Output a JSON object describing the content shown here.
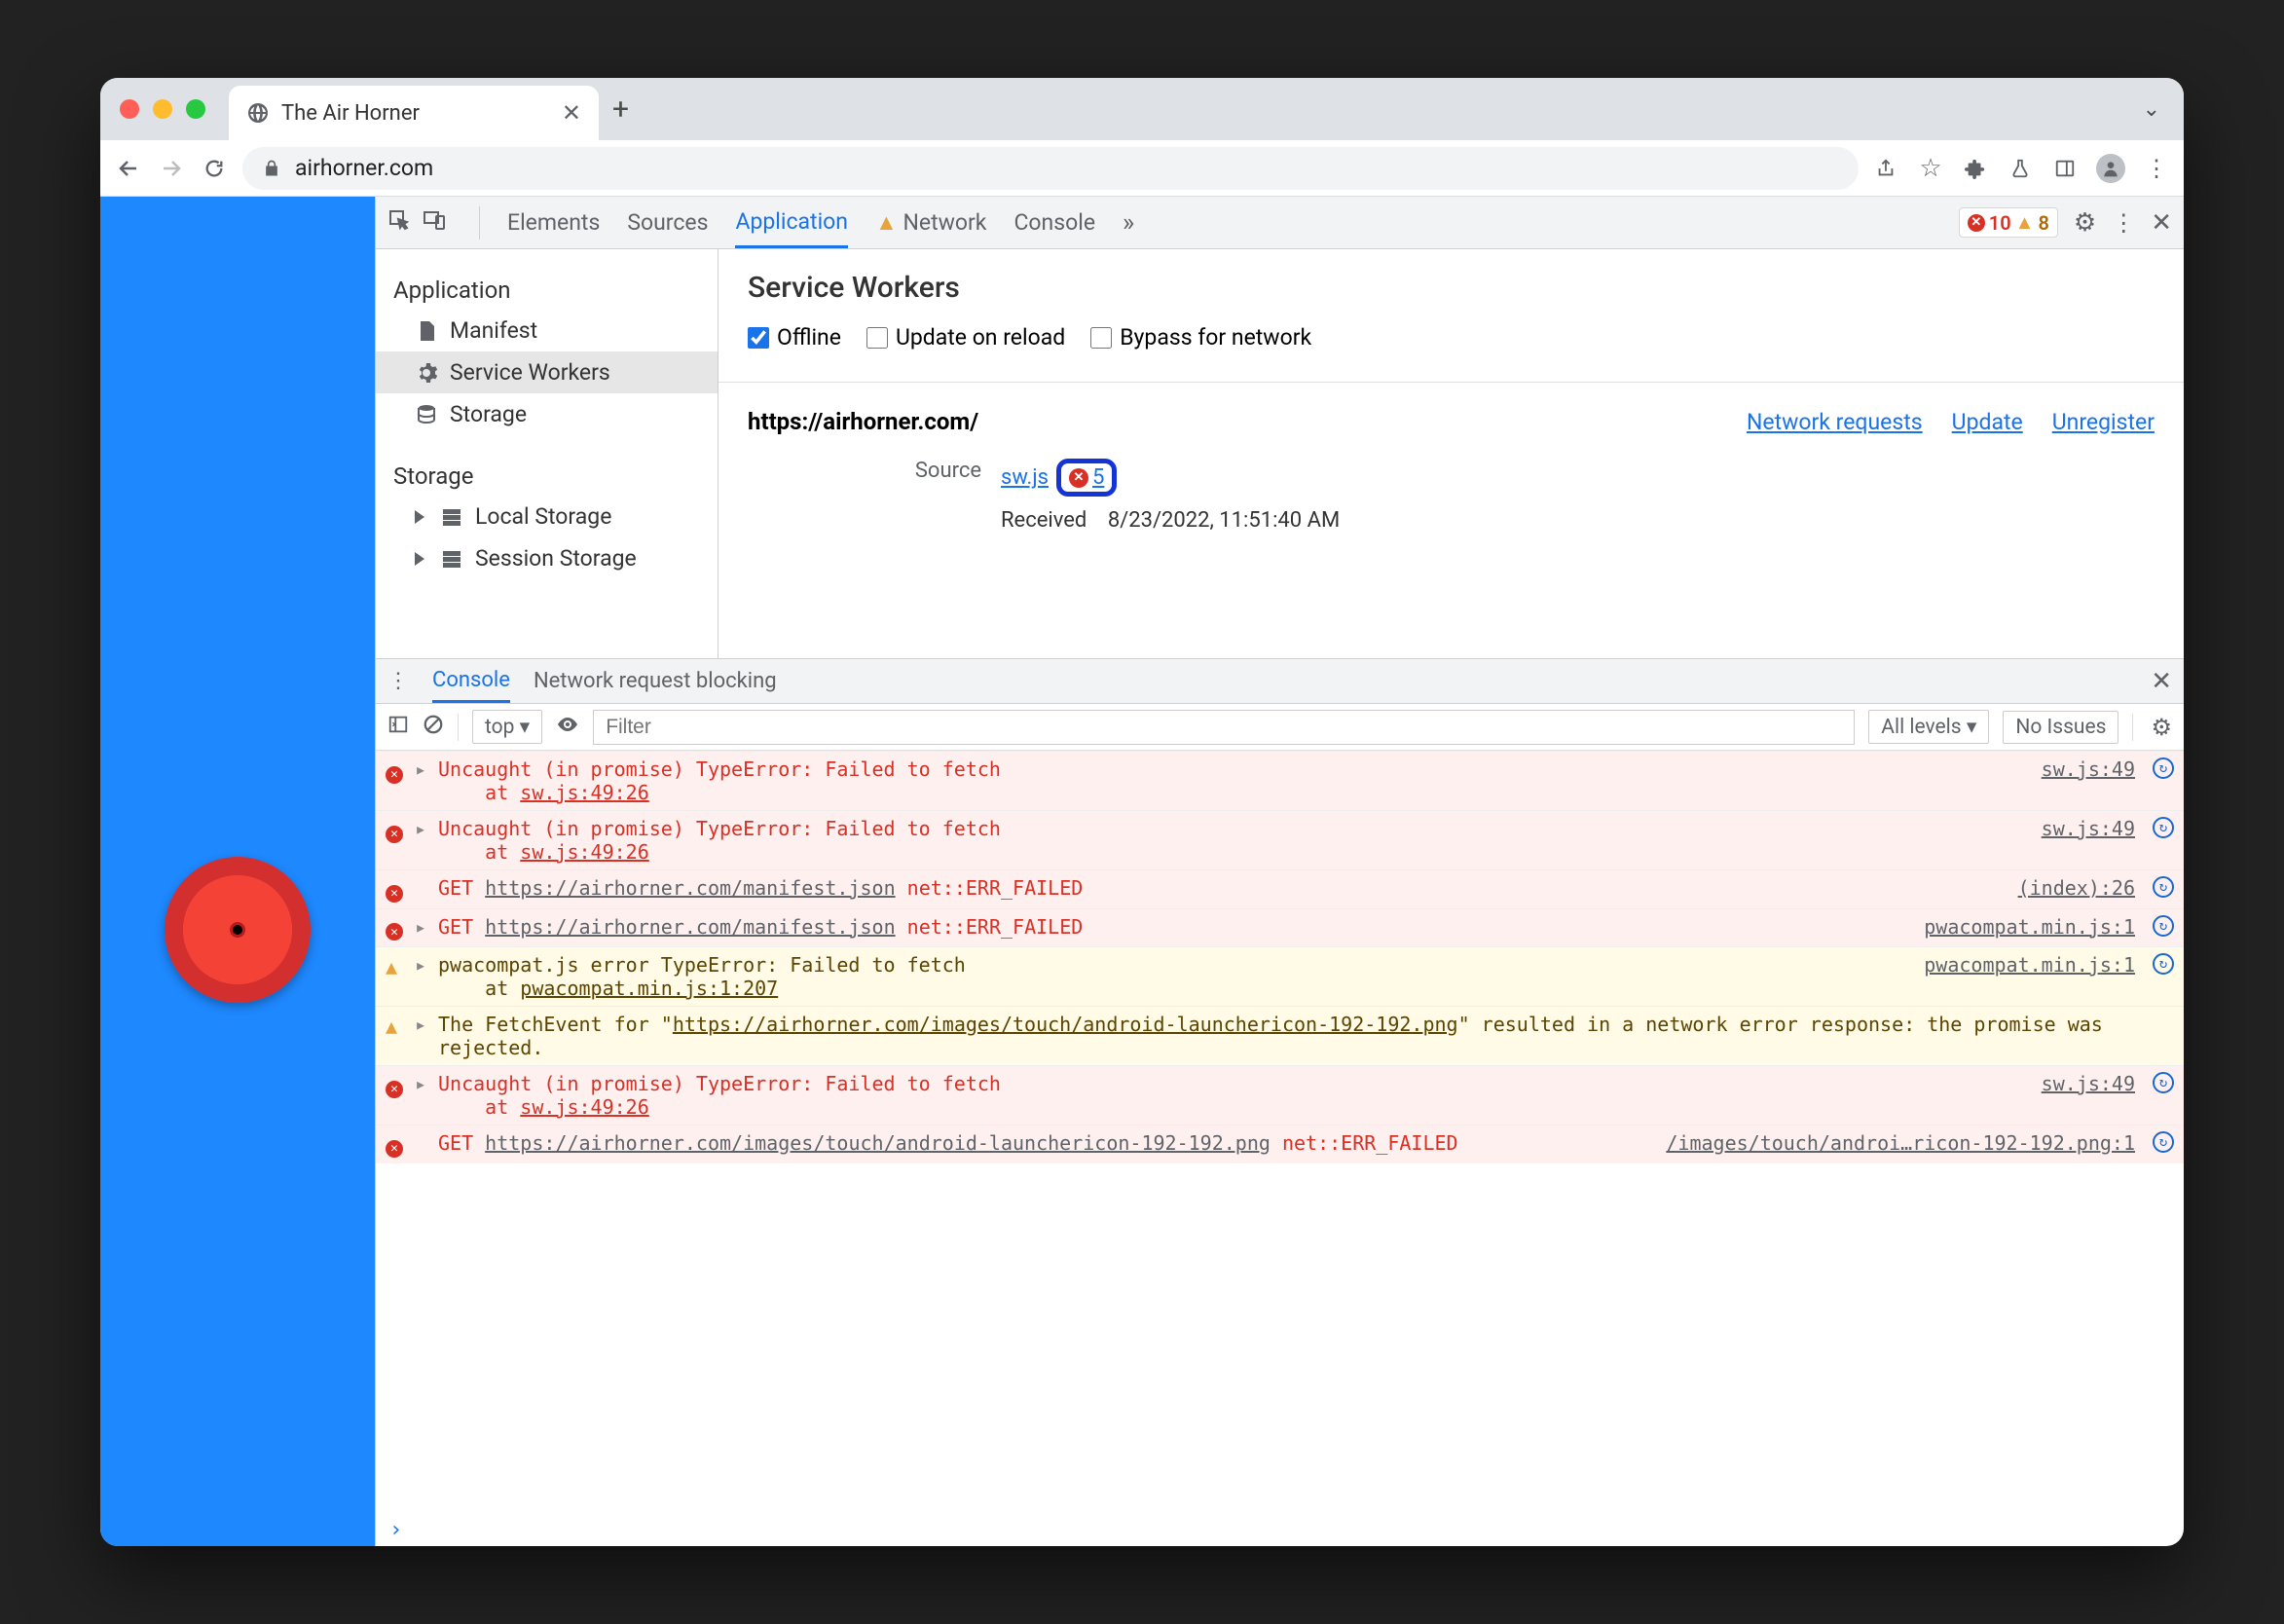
{
  "browser": {
    "tab_title": "The Air Horner",
    "url": "airhorner.com"
  },
  "devtools": {
    "tabs": [
      "Elements",
      "Sources",
      "Application",
      "Network",
      "Console"
    ],
    "active_tab": "Application",
    "error_count": "10",
    "warning_count": "8"
  },
  "app_sidebar": {
    "g1_header": "Application",
    "g1_items": [
      "Manifest",
      "Service Workers",
      "Storage"
    ],
    "g2_header": "Storage",
    "g2_items": [
      "Local Storage",
      "Session Storage"
    ]
  },
  "sw_panel": {
    "title": "Service Workers",
    "chk_offline": "Offline",
    "chk_update": "Update on reload",
    "chk_bypass": "Bypass for network",
    "origin": "https://airhorner.com/",
    "link_net": "Network requests",
    "link_upd": "Update",
    "link_unreg": "Unregister",
    "src_label": "Source",
    "src_file": "sw.js",
    "err_count": "5",
    "recv_label": "Received",
    "recv_value": "8/23/2022, 11:51:40 AM"
  },
  "drawer": {
    "tab_console": "Console",
    "tab_netblock": "Network request blocking",
    "context": "top",
    "filter_ph": "Filter",
    "levels": "All levels",
    "issues": "No Issues"
  },
  "logs": [
    {
      "type": "err",
      "expand": true,
      "msg": "Uncaught (in promise) TypeError: Failed to fetch",
      "stack": "    at ",
      "stack_link": "sw.js:49:26",
      "src": "sw.js:49"
    },
    {
      "type": "err",
      "expand": true,
      "msg": "Uncaught (in promise) TypeError: Failed to fetch",
      "stack": "    at ",
      "stack_link": "sw.js:49:26",
      "src": "sw.js:49"
    },
    {
      "type": "err",
      "expand": false,
      "prefix": "GET ",
      "url": "https://airhorner.com/manifest.json",
      "suffix": " net::ERR_FAILED",
      "src": "(index):26"
    },
    {
      "type": "err",
      "expand": true,
      "prefix": "GET ",
      "url": "https://airhorner.com/manifest.json",
      "suffix": " net::ERR_FAILED",
      "src": "pwacompat.min.js:1"
    },
    {
      "type": "wrn",
      "expand": true,
      "msg": "pwacompat.js error TypeError: Failed to fetch",
      "stack": "    at ",
      "stack_link": "pwacompat.min.js:1:207",
      "src": "pwacompat.min.js:1"
    },
    {
      "type": "wrn",
      "expand": true,
      "pre": "The FetchEvent for \"",
      "url": "https://airhorner.com/images/touch/android-launchericon-192-192.png",
      "post": "\" resulted in a network error response: the promise was rejected.",
      "src": ""
    },
    {
      "type": "err",
      "expand": true,
      "msg": "Uncaught (in promise) TypeError: Failed to fetch",
      "stack": "    at ",
      "stack_link": "sw.js:49:26",
      "src": "sw.js:49"
    },
    {
      "type": "err",
      "expand": false,
      "prefix": "GET ",
      "url": "https://airhorner.com/images/touch/android-launchericon-192-192.png",
      "suffix": " net::ERR_FAILED",
      "src": "/images/touch/androi…ricon-192-192.png:1"
    }
  ]
}
